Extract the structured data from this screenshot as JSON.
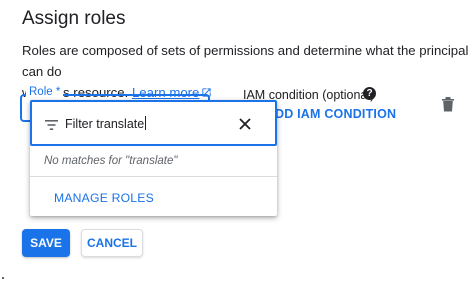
{
  "panel": {
    "title": "Assign roles",
    "description_line1": "Roles are composed of sets of permissions and determine what the principal can do",
    "description_line2": "with this resource.",
    "learn_more": "Learn more"
  },
  "role_field": {
    "label": "Role *"
  },
  "iam_condition": {
    "heading": "IAM condition (optional)",
    "add_label": "DD IAM CONDITION"
  },
  "dropdown": {
    "filter_label": "Filter",
    "filter_value": "translate",
    "no_match_text": "No matches for \"translate\"",
    "manage_roles": "MANAGE ROLES"
  },
  "actions": {
    "save": "SAVE",
    "cancel": "CANCEL"
  },
  "colors": {
    "accent": "#1a73e8",
    "text": "#202124",
    "muted": "#5f6368"
  }
}
